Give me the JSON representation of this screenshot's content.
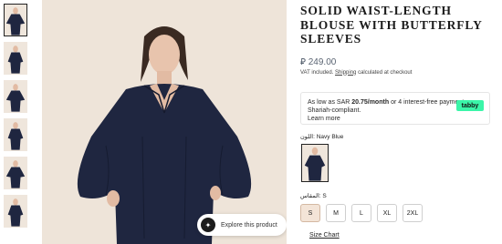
{
  "gallery": {
    "thumbnails": [
      {
        "label": "thumbnail-1",
        "active": true
      },
      {
        "label": "thumbnail-2",
        "active": false
      },
      {
        "label": "thumbnail-3",
        "active": false
      },
      {
        "label": "thumbnail-4",
        "active": false
      },
      {
        "label": "thumbnail-5",
        "active": false
      },
      {
        "label": "thumbnail-6",
        "active": false
      }
    ],
    "explore_label": "Explore this product",
    "explore_icon": "sparkle-icon"
  },
  "product": {
    "title": "SOLID WAIST-LENGTH BLOUSE WITH BUTTERFLY SLEEVES",
    "currency_symbol": "⃁",
    "price": "249.00",
    "vat_text": "VAT included.",
    "shipping_link": "Shipping",
    "shipping_suffix": "calculated at checkout"
  },
  "tabby": {
    "prefix": "As low as SAR",
    "amount": "20.75/month",
    "suffix": "or 4 interest-free payments. Shariah-compliant.",
    "learn_more": "Learn more",
    "logo_text": "tabby",
    "logo_color": "#3bf5a8"
  },
  "options": {
    "color_label": "اللون:",
    "color_value": "Navy Blue",
    "size_label": "المقاس:",
    "size_value": "S",
    "sizes": [
      "S",
      "M",
      "L",
      "XL",
      "2XL"
    ],
    "selected_size": "S",
    "size_chart": "Size Chart"
  },
  "colors": {
    "blouse": "#1f2640",
    "background": "#eee4d9",
    "selected_size_bg": "#f3e4d7"
  }
}
